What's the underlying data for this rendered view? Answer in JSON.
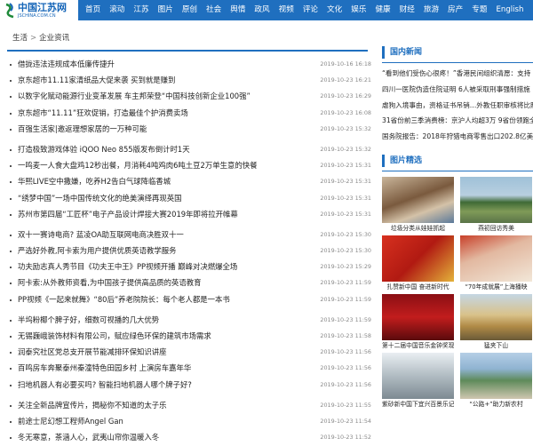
{
  "site": {
    "logo_text": "中国江苏网",
    "logo_sub": "JSCHINA.COM.CN"
  },
  "nav": [
    "首页",
    "滚动",
    "江苏",
    "图片",
    "原创",
    "社会",
    "舆情",
    "政风",
    "视频",
    "评论",
    "文化",
    "娱乐",
    "健康",
    "财经",
    "旅游",
    "房产",
    "专题",
    "English"
  ],
  "breadcrumb": {
    "home": "生活",
    "sep": ">",
    "current": "企业资讯"
  },
  "news": [
    {
      "title": "借拢违法违规成本低廉传捷升",
      "date": "2019-10-16 16:18"
    },
    {
      "title": "京东超市11.11家清纸品大促来袭 买到就是赚到",
      "date": "2019-10-23 16:21"
    },
    {
      "title": "以数字化赋动能源行业变革发展 车主邦荣登“中国科技创新企业100强”",
      "date": "2019-10-23 16:29"
    },
    {
      "title": "京东超市“11.11”狂欢促销，打造最佳个护消费卖场",
      "date": "2019-10-23 16:08"
    },
    {
      "title": "百强生活家|邀返理想家居的一万种可能",
      "date": "2019-10-23 15:32"
    },
    {
      "title": "打造极致游戏体验 iQOO Neo 855版发布倒计时1天",
      "date": "2019-10-23 15:32"
    },
    {
      "title": "一鸣麦一人食大盘鸡12秒出餐，月消耗4吨鸡肉6吨土豆2万单生意的快餐",
      "date": "2019-10-23 15:31"
    },
    {
      "title": "华熙LIVE空中撒嫌，吃养H2告白气球降临香城",
      "date": "2019-10-23 15:31"
    },
    {
      "title": "“绣梦中国”一场中国传统文化的绝美演绎再现英国",
      "date": "2019-10-23 15:31"
    },
    {
      "title": "苏州市第四届“工匠杯”电子产品设计焊接大赛2019年即将拉开帷幕",
      "date": "2019-10-23 15:31"
    },
    {
      "title": "双十一赛诗电商? 蓝凌OA助互联网电商决胜双十一",
      "date": "2019-10-23 15:30"
    },
    {
      "title": "严选好外教,阿卡索为用户提供优质英语教学服务",
      "date": "2019-10-23 15:30"
    },
    {
      "title": "功夫励志真人秀节目《功夫王中王》PP视频开播 巅峰对决燃爆全场",
      "date": "2019-10-23 15:29"
    },
    {
      "title": "阿卡索:从外教师资看,为中国孩子提供高品质的英语教育",
      "date": "2019-10-23 11:59"
    },
    {
      "title": "PP视频《一起来就舞》“80后”养老院院长：每个老人都是一本书",
      "date": "2019-10-23 11:59"
    },
    {
      "title": "半坞粉椰个脾子好，细数可视播的几大优势",
      "date": "2019-10-23 11:59"
    },
    {
      "title": "无锡巍峨装饰材料有限公司，赋应绿色环保的建筑市场需求",
      "date": "2019-10-23 11:58"
    },
    {
      "title": "润泰究社区党总支开展节能减排环保知识讲座",
      "date": "2019-10-23 11:56"
    },
    {
      "title": "百鸣房车奔聚泰州秦潼特色田园乡村 上演房车嘉年华",
      "date": "2019-10-23 11:56"
    },
    {
      "title": "扫地机器人有必要买吗? 智能扫地机器人哪个牌子好?",
      "date": "2019-10-23 11:56"
    },
    {
      "title": "关注全新品牌宣传片，揭秘你不知道的太子乐",
      "date": "2019-10-23 11:55"
    },
    {
      "title": "前途士尼幻想工程师Angel Gan",
      "date": "2019-10-23 11:54"
    },
    {
      "title": "冬无寒意，茶涵人心，武夷山帘你温暖入冬",
      "date": "2019-10-23 11:52"
    }
  ],
  "right": {
    "domestic_title": "国内新闻",
    "domestic": [
      "“看到他们受伤心很疼！”香港民间组织清愿：支持",
      "四川一医院伪造住院证明 6人被采取刑事强制措施",
      "虐狗入境事由，资格证书吊销…外教任职审核将比照",
      "31省份前三季消费榜：京沪人均超3万 9省份领跑全",
      "国务院报告：2018年狩猎电商零售出口202.8亿美"
    ],
    "photo_title": "图片精选",
    "photos": [
      "垃圾分类从娃娃抓起",
      "燕初回访秀美",
      "扎赞新中国 奋进新时代",
      "“70年成就展”上海播映",
      "第十二届中国音乐金钟奖现",
      "猛夹下山",
      "紫砂新中国下宜兴百景乐记",
      "“公路+”助力新农村"
    ]
  },
  "colors": {
    "brand": "#1f6fbf",
    "text": "#222222",
    "date": "#888888"
  }
}
